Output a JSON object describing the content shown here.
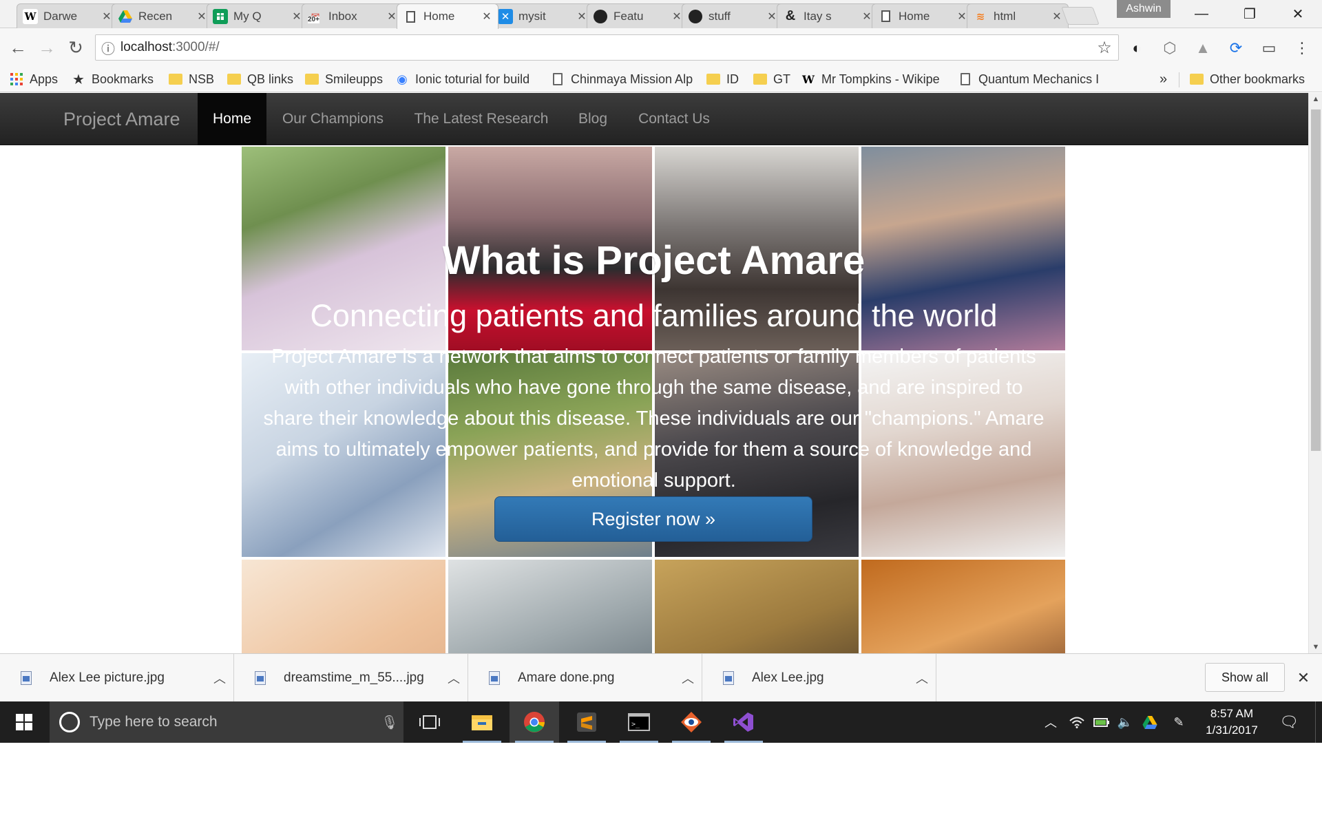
{
  "browser": {
    "tabs": [
      {
        "title": "Darwe",
        "icon": "wikipedia-icon",
        "active": false
      },
      {
        "title": "Recen",
        "icon": "google-drive-icon",
        "active": false
      },
      {
        "title": "My Q",
        "icon": "google-sheets-icon",
        "active": false
      },
      {
        "title": "Inbox",
        "icon": "gmail-icon",
        "badge": "20+",
        "active": false
      },
      {
        "title": "Home",
        "icon": "page-icon",
        "active": true
      },
      {
        "title": "mysit",
        "icon": "x-site-icon",
        "active": false
      },
      {
        "title": "Featu",
        "icon": "github-icon",
        "active": false
      },
      {
        "title": "stuff",
        "icon": "github-icon",
        "active": false
      },
      {
        "title": "Itay s",
        "icon": "ampersand-icon",
        "active": false
      },
      {
        "title": "Home",
        "icon": "page-icon",
        "active": false
      },
      {
        "title": "html",
        "icon": "stackoverflow-icon",
        "active": false
      }
    ],
    "profile_name": "Ashwin",
    "url_host": "localhost",
    "url_path": ":3000/#/",
    "bookmarks": [
      {
        "label": "Apps",
        "icon": "apps-grid-icon"
      },
      {
        "label": "Bookmarks",
        "icon": "star-icon"
      },
      {
        "label": "NSB",
        "icon": "folder-icon"
      },
      {
        "label": "QB links",
        "icon": "folder-icon"
      },
      {
        "label": "Smileupps",
        "icon": "folder-icon"
      },
      {
        "label": "Ionic toturial for build",
        "icon": "ionic-icon"
      },
      {
        "label": "Chinmaya Mission Alp",
        "icon": "page-icon"
      },
      {
        "label": "ID",
        "icon": "folder-icon"
      },
      {
        "label": "GT",
        "icon": "folder-icon"
      },
      {
        "label": "Mr Tompkins - Wikipe",
        "icon": "wikipedia-icon"
      },
      {
        "label": "Quantum Mechanics I",
        "icon": "page-icon"
      }
    ],
    "bookmarks_overflow": "»",
    "other_bookmarks": "Other bookmarks"
  },
  "site": {
    "brand": "Project Amare",
    "nav": [
      {
        "label": "Home",
        "active": true
      },
      {
        "label": "Our Champions",
        "active": false
      },
      {
        "label": "The Latest Research",
        "active": false
      },
      {
        "label": "Blog",
        "active": false
      },
      {
        "label": "Contact Us",
        "active": false
      }
    ],
    "hero": {
      "title": "What is Project Amare",
      "subtitle": "Connecting patients and families around the world",
      "body": "Project Amare is a network that aims to connect patients or family members of patients with other individuals who have gone through the same disease, and are inspired to share their knowledge about this disease. These individuals are our \"champions.\" Amare aims to ultimately empower patients, and provide for them a source of knowledge and emotional support.",
      "cta": "Register now »"
    }
  },
  "downloads": {
    "items": [
      {
        "name": "Alex Lee picture.jpg"
      },
      {
        "name": "dreamstime_m_55....jpg"
      },
      {
        "name": "Amare done.png"
      },
      {
        "name": "Alex Lee.jpg"
      }
    ],
    "show_all": "Show all"
  },
  "taskbar": {
    "search_placeholder": "Type here to search",
    "time": "8:57 AM",
    "date": "1/31/2017"
  }
}
